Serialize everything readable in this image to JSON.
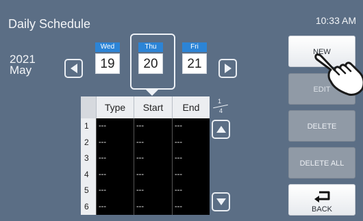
{
  "header": {
    "title": "Daily Schedule",
    "clock": "10:33 AM"
  },
  "date": {
    "year": "2021",
    "month": "May"
  },
  "days": [
    {
      "name": "Wed",
      "num": "19"
    },
    {
      "name": "Thu",
      "num": "20"
    },
    {
      "name": "Fri",
      "num": "21"
    }
  ],
  "selected_day": "Thu",
  "table": {
    "columns": [
      "Type",
      "Start",
      "End"
    ],
    "rows": [
      {
        "num": "1",
        "type": "---",
        "start": "---",
        "end": "---"
      },
      {
        "num": "2",
        "type": "---",
        "start": "---",
        "end": "---"
      },
      {
        "num": "3",
        "type": "---",
        "start": "---",
        "end": "---"
      },
      {
        "num": "4",
        "type": "---",
        "start": "---",
        "end": "---"
      },
      {
        "num": "5",
        "type": "---",
        "start": "---",
        "end": "---"
      },
      {
        "num": "6",
        "type": "---",
        "start": "---",
        "end": "---"
      }
    ]
  },
  "pager": {
    "current": "1",
    "total": "4"
  },
  "buttons": {
    "new": "NEW",
    "edit": "EDIT",
    "delete": "DELETE",
    "delete_all": "DELETE ALL",
    "back": "BACK"
  },
  "icons": {
    "prev": "chevron-left-icon",
    "next": "chevron-right-icon",
    "up": "triangle-up-icon",
    "down": "triangle-down-icon",
    "back": "return-arrow-icon",
    "pointer": "pointing-hand-icon"
  },
  "colors": {
    "background": "#5b6e85",
    "day_header": "#2c84d6",
    "table_body": "#000000",
    "disabled_button": "#909aa6"
  }
}
